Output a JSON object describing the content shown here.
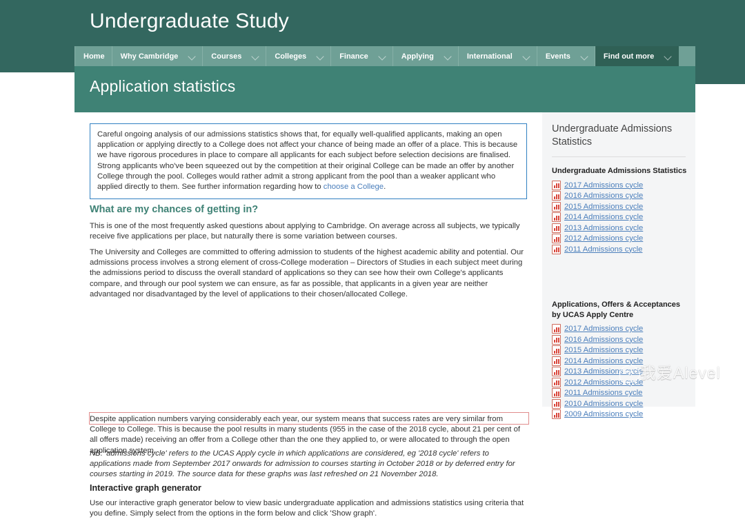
{
  "site": {
    "title": "Undergraduate Study"
  },
  "nav": {
    "items": [
      {
        "label": "Home",
        "has_caret": false,
        "active": false
      },
      {
        "label": "Why Cambridge",
        "has_caret": true,
        "active": false
      },
      {
        "label": "Courses",
        "has_caret": true,
        "active": false
      },
      {
        "label": "Colleges",
        "has_caret": true,
        "active": false
      },
      {
        "label": "Finance",
        "has_caret": true,
        "active": false
      },
      {
        "label": "Applying",
        "has_caret": true,
        "active": false
      },
      {
        "label": "International",
        "has_caret": true,
        "active": false
      },
      {
        "label": "Events",
        "has_caret": true,
        "active": false
      },
      {
        "label": "Find out more",
        "has_caret": true,
        "active": true
      }
    ]
  },
  "page": {
    "title": "Application statistics"
  },
  "infobox": {
    "text_before_link": "Careful ongoing analysis of our admissions statistics shows that, for equally well-qualified applicants, making an open application or applying directly to a College does not affect your chance of being made an offer of a place. This is because we have rigorous procedures in place to compare all applicants for each subject before selection decisions are finalised. Strong applicants who've been squeezed out by the competition at their original College can be made an offer by another College through the pool. Colleges would rather admit a strong applicant from the pool than a weaker applicant who applied directly to them. See further information regarding how to ",
    "link_text": "choose a College",
    "text_after_link": "."
  },
  "main": {
    "heading": "What are my chances of getting in?",
    "paragraph_1": "This is one of the most frequently asked questions about applying to Cambridge. On average across all subjects, we typically receive five applications per place, but naturally there is some variation between courses.",
    "paragraph_2": "The University and Colleges are committed to offering admission to students of the highest academic ability and potential. Our admissions process involves a strong element of cross-College moderation – Directors of Studies in each subject meet during the admissions period to discuss the overall standard of applications so they can see how their own College's applicants compare, and through our pool system we can ensure, as far as possible, that applicants in a given year are neither advantaged nor disadvantaged by the level of applications to their chosen/allocated College.",
    "paragraph_3": "Despite application numbers varying considerably each year, our system means that success rates are very similar from College to College. This is because the pool results in many students (955 in the case of the 2018 cycle, about 21 per cent of all offers made) receiving an offer from a College other than the one they applied to, or were allocated to through the open application system.",
    "paragraph_4": "NB: 'admissions cycle' refers to the UCAS Apply cycle in which applications are considered, eg '2018 cycle' refers to applications made from September 2017 onwards for admission to courses starting in October 2018 or by deferred entry for courses starting in 2019. The source data for these graphs was last refreshed on 21 November 2018.",
    "heading_2": "Interactive graph generator",
    "paragraph_5": "Use our interactive graph generator below to view basic undergraduate application and admissions statistics using criteria that you define. Simply select from the options in the form below and click 'Show graph'."
  },
  "sidebar": {
    "title": "Undergraduate Admissions Statistics",
    "groups": [
      {
        "heading": "Undergraduate Admissions Statistics",
        "links": [
          "2017 Admissions cycle",
          "2016 Admissions cycle",
          "2015 Admissions cycle",
          "2014 Admissions cycle",
          "2013 Admissions cycle",
          "2012 Admissions cycle",
          "2011 Admissions cycle"
        ]
      },
      {
        "heading": "Applications, Offers & Acceptances by UCAS Apply Centre",
        "links": [
          "2017 Admissions cycle",
          "2016 Admissions cycle",
          "2015 Admissions cycle",
          "2014 Admissions cycle",
          "2013 Admissions cycle",
          "2012 Admissions cycle",
          "2011 Admissions cycle",
          "2010 Admissions cycle",
          "2009 Admissions cycle"
        ]
      }
    ]
  },
  "watermark": {
    "text": "我爱Alevel"
  },
  "colors": {
    "brand_dark_teal": "#33675f",
    "brand_teal": "#3f8275",
    "nav_teal": "#6fa096",
    "nav_active": "#2f6055",
    "link_blue": "#4a7ebb",
    "infobox_border": "#2f7fc1",
    "redbox_border": "#e08b8b",
    "sidebar_bg": "#f4f5f6"
  }
}
